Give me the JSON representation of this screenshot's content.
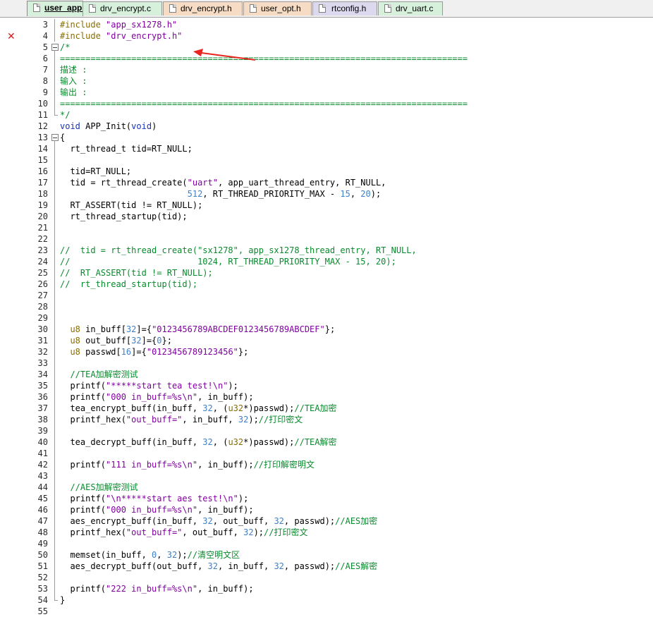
{
  "tabs": [
    {
      "label": "user_app.c",
      "kind": "c",
      "active": true
    },
    {
      "label": "drv_encrypt.c",
      "kind": "c",
      "active": false
    },
    {
      "label": "drv_encrypt.h",
      "kind": "h",
      "active": false
    },
    {
      "label": "user_opt.h",
      "kind": "h",
      "active": false
    },
    {
      "label": "rtconfig.h",
      "kind": "rt",
      "active": false
    },
    {
      "label": "drv_uart.c",
      "kind": "c",
      "active": false
    }
  ],
  "error_marker": "✕",
  "lines": [
    {
      "n": "3",
      "fold": "line",
      "tokens": [
        [
          "pp",
          "#include "
        ],
        [
          "str",
          "\"app_sx1278.h\""
        ]
      ]
    },
    {
      "n": "4",
      "fold": "line",
      "tokens": [
        [
          "pp",
          "#include "
        ],
        [
          "str",
          "\"drv_encrypt.h\""
        ]
      ]
    },
    {
      "n": "5",
      "fold": "box",
      "tokens": [
        [
          "cm",
          "/*"
        ]
      ]
    },
    {
      "n": "6",
      "fold": "line",
      "tokens": [
        [
          "sep",
          "================================================================================"
        ]
      ]
    },
    {
      "n": "7",
      "fold": "line",
      "tokens": [
        [
          "cm",
          "描述 :"
        ]
      ]
    },
    {
      "n": "8",
      "fold": "line",
      "tokens": [
        [
          "cm",
          "输入 :"
        ]
      ]
    },
    {
      "n": "9",
      "fold": "line",
      "tokens": [
        [
          "cm",
          "输出 :"
        ]
      ]
    },
    {
      "n": "10",
      "fold": "line",
      "tokens": [
        [
          "sep",
          "================================================================================"
        ]
      ]
    },
    {
      "n": "11",
      "fold": "end",
      "tokens": [
        [
          "cm",
          "*/"
        ]
      ]
    },
    {
      "n": "12",
      "fold": "none",
      "tokens": [
        [
          "kw",
          "void"
        ],
        [
          "plain",
          " APP_Init("
        ],
        [
          "kw",
          "void"
        ],
        [
          "plain",
          ")"
        ]
      ]
    },
    {
      "n": "13",
      "fold": "box",
      "tokens": [
        [
          "plain",
          "{"
        ]
      ]
    },
    {
      "n": "14",
      "fold": "line",
      "tokens": [
        [
          "plain",
          "  rt_thread_t tid=RT_NULL;"
        ]
      ]
    },
    {
      "n": "15",
      "fold": "line",
      "tokens": []
    },
    {
      "n": "16",
      "fold": "line",
      "tokens": [
        [
          "plain",
          "  tid=RT_NULL;"
        ]
      ]
    },
    {
      "n": "17",
      "fold": "line",
      "tokens": [
        [
          "plain",
          "  tid = rt_thread_create("
        ],
        [
          "str",
          "\"uart\""
        ],
        [
          "plain",
          ", app_uart_thread_entry, RT_NULL,"
        ]
      ]
    },
    {
      "n": "18",
      "fold": "line",
      "tokens": [
        [
          "plain",
          "                         "
        ],
        [
          "num",
          "512"
        ],
        [
          "plain",
          ", RT_THREAD_PRIORITY_MAX - "
        ],
        [
          "num",
          "15"
        ],
        [
          "plain",
          ", "
        ],
        [
          "num",
          "20"
        ],
        [
          "plain",
          ");"
        ]
      ]
    },
    {
      "n": "19",
      "fold": "line",
      "tokens": [
        [
          "plain",
          "  RT_ASSERT(tid != RT_NULL);"
        ]
      ]
    },
    {
      "n": "20",
      "fold": "line",
      "tokens": [
        [
          "plain",
          "  rt_thread_startup(tid);"
        ]
      ]
    },
    {
      "n": "21",
      "fold": "line",
      "tokens": []
    },
    {
      "n": "22",
      "fold": "line",
      "tokens": []
    },
    {
      "n": "23",
      "fold": "line",
      "tokens": [
        [
          "cm",
          "//  tid = rt_thread_create(\"sx1278\", app_sx1278_thread_entry, RT_NULL,"
        ]
      ]
    },
    {
      "n": "24",
      "fold": "line",
      "tokens": [
        [
          "cm",
          "//                         1024, RT_THREAD_PRIORITY_MAX - 15, 20);"
        ]
      ]
    },
    {
      "n": "25",
      "fold": "line",
      "tokens": [
        [
          "cm",
          "//  RT_ASSERT(tid != RT_NULL);"
        ]
      ]
    },
    {
      "n": "26",
      "fold": "line",
      "tokens": [
        [
          "cm",
          "//  rt_thread_startup(tid);"
        ]
      ]
    },
    {
      "n": "27",
      "fold": "line",
      "tokens": []
    },
    {
      "n": "28",
      "fold": "line",
      "tokens": []
    },
    {
      "n": "29",
      "fold": "line",
      "tokens": []
    },
    {
      "n": "30",
      "fold": "line",
      "tokens": [
        [
          "plain",
          "  "
        ],
        [
          "pp",
          "u8"
        ],
        [
          "plain",
          " in_buff["
        ],
        [
          "num",
          "32"
        ],
        [
          "plain",
          "]={"
        ],
        [
          "str",
          "\"0123456789ABCDEF0123456789ABCDEF\""
        ],
        [
          "plain",
          "};"
        ]
      ]
    },
    {
      "n": "31",
      "fold": "line",
      "tokens": [
        [
          "plain",
          "  "
        ],
        [
          "pp",
          "u8"
        ],
        [
          "plain",
          " out_buff["
        ],
        [
          "num",
          "32"
        ],
        [
          "plain",
          "]={"
        ],
        [
          "num",
          "0"
        ],
        [
          "plain",
          "};"
        ]
      ]
    },
    {
      "n": "32",
      "fold": "line",
      "tokens": [
        [
          "plain",
          "  "
        ],
        [
          "pp",
          "u8"
        ],
        [
          "plain",
          " passwd["
        ],
        [
          "num",
          "16"
        ],
        [
          "plain",
          "]={"
        ],
        [
          "str",
          "\"0123456789123456\""
        ],
        [
          "plain",
          "};"
        ]
      ]
    },
    {
      "n": "33",
      "fold": "line",
      "tokens": []
    },
    {
      "n": "34",
      "fold": "line",
      "tokens": [
        [
          "plain",
          "  "
        ],
        [
          "cm",
          "//TEA加解密测试"
        ]
      ]
    },
    {
      "n": "35",
      "fold": "line",
      "tokens": [
        [
          "plain",
          "  printf("
        ],
        [
          "str",
          "\"*****start tea test!\\n\""
        ],
        [
          "plain",
          ");"
        ]
      ]
    },
    {
      "n": "36",
      "fold": "line",
      "tokens": [
        [
          "plain",
          "  printf("
        ],
        [
          "str",
          "\"000 in_buff=%s\\n\""
        ],
        [
          "plain",
          ", in_buff);"
        ]
      ]
    },
    {
      "n": "37",
      "fold": "line",
      "tokens": [
        [
          "plain",
          "  tea_encrypt_buff(in_buff, "
        ],
        [
          "num",
          "32"
        ],
        [
          "plain",
          ", ("
        ],
        [
          "pp",
          "u32"
        ],
        [
          "plain",
          "*)passwd);"
        ],
        [
          "cm",
          "//TEA加密"
        ]
      ]
    },
    {
      "n": "38",
      "fold": "line",
      "tokens": [
        [
          "plain",
          "  printf_hex("
        ],
        [
          "str",
          "\"out_buff=\""
        ],
        [
          "plain",
          ", in_buff, "
        ],
        [
          "num",
          "32"
        ],
        [
          "plain",
          ");"
        ],
        [
          "cm",
          "//打印密文"
        ]
      ]
    },
    {
      "n": "39",
      "fold": "line",
      "tokens": []
    },
    {
      "n": "40",
      "fold": "line",
      "tokens": [
        [
          "plain",
          "  tea_decrypt_buff(in_buff, "
        ],
        [
          "num",
          "32"
        ],
        [
          "plain",
          ", ("
        ],
        [
          "pp",
          "u32"
        ],
        [
          "plain",
          "*)passwd);"
        ],
        [
          "cm",
          "//TEA解密"
        ]
      ]
    },
    {
      "n": "41",
      "fold": "line",
      "tokens": []
    },
    {
      "n": "42",
      "fold": "line",
      "tokens": [
        [
          "plain",
          "  printf("
        ],
        [
          "str",
          "\"111 in_buff=%s\\n\""
        ],
        [
          "plain",
          ", in_buff);"
        ],
        [
          "cm",
          "//打印解密明文"
        ]
      ]
    },
    {
      "n": "43",
      "fold": "line",
      "tokens": []
    },
    {
      "n": "44",
      "fold": "line",
      "tokens": [
        [
          "plain",
          "  "
        ],
        [
          "cm",
          "//AES加解密测试"
        ]
      ]
    },
    {
      "n": "45",
      "fold": "line",
      "tokens": [
        [
          "plain",
          "  printf("
        ],
        [
          "str",
          "\"\\n*****start aes test!\\n\""
        ],
        [
          "plain",
          ");"
        ]
      ]
    },
    {
      "n": "46",
      "fold": "line",
      "tokens": [
        [
          "plain",
          "  printf("
        ],
        [
          "str",
          "\"000 in_buff=%s\\n\""
        ],
        [
          "plain",
          ", in_buff);"
        ]
      ]
    },
    {
      "n": "47",
      "fold": "line",
      "tokens": [
        [
          "plain",
          "  aes_encrypt_buff(in_buff, "
        ],
        [
          "num",
          "32"
        ],
        [
          "plain",
          ", out_buff, "
        ],
        [
          "num",
          "32"
        ],
        [
          "plain",
          ", passwd);"
        ],
        [
          "cm",
          "//AES加密"
        ]
      ]
    },
    {
      "n": "48",
      "fold": "line",
      "tokens": [
        [
          "plain",
          "  printf_hex("
        ],
        [
          "str",
          "\"out_buff=\""
        ],
        [
          "plain",
          ", out_buff, "
        ],
        [
          "num",
          "32"
        ],
        [
          "plain",
          ");"
        ],
        [
          "cm",
          "//打印密文"
        ]
      ]
    },
    {
      "n": "49",
      "fold": "line",
      "tokens": []
    },
    {
      "n": "50",
      "fold": "line",
      "tokens": [
        [
          "plain",
          "  memset(in_buff, "
        ],
        [
          "num",
          "0"
        ],
        [
          "plain",
          ", "
        ],
        [
          "num",
          "32"
        ],
        [
          "plain",
          ");"
        ],
        [
          "cm",
          "//清空明文区"
        ]
      ]
    },
    {
      "n": "51",
      "fold": "line",
      "tokens": [
        [
          "plain",
          "  aes_decrypt_buff(out_buff, "
        ],
        [
          "num",
          "32"
        ],
        [
          "plain",
          ", in_buff, "
        ],
        [
          "num",
          "32"
        ],
        [
          "plain",
          ", passwd);"
        ],
        [
          "cm",
          "//AES解密"
        ]
      ]
    },
    {
      "n": "52",
      "fold": "line",
      "tokens": []
    },
    {
      "n": "53",
      "fold": "line",
      "tokens": [
        [
          "plain",
          "  printf("
        ],
        [
          "str",
          "\"222 in_buff=%s\\n\""
        ],
        [
          "plain",
          ", in_buff);"
        ]
      ]
    },
    {
      "n": "54",
      "fold": "end",
      "tokens": [
        [
          "plain",
          "}"
        ]
      ]
    },
    {
      "n": "55",
      "fold": "none",
      "tokens": []
    }
  ]
}
